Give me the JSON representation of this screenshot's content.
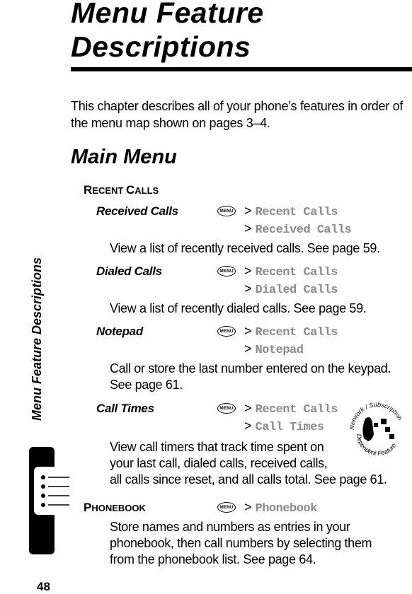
{
  "page": {
    "chapter_title_line1": "Menu Feature",
    "chapter_title_line2": "Descriptions",
    "intro": "This chapter describes all of your phone’s features in order of the menu map shown on pages 3–4.",
    "section_title": "Main Menu",
    "side_tab_title": "Menu Feature Descriptions",
    "page_number": "48",
    "menu_key_label": "MENU",
    "separator": ">",
    "badge": {
      "icon": "network-subscription-feature-icon",
      "top_text": "Network / Subscription",
      "bottom_text": "Dependent Feature"
    }
  },
  "recent_calls": {
    "heading_first": "R",
    "heading_rest1": "ECENT ",
    "heading_c": "C",
    "heading_rest2": "ALLS",
    "features": [
      {
        "name": "Received Calls",
        "path": [
          "Recent Calls",
          "Received Calls"
        ],
        "desc_lines": [
          "View a list of recently received calls. See page 59."
        ]
      },
      {
        "name": "Dialed Calls",
        "path": [
          "Recent Calls",
          "Dialed Calls"
        ],
        "desc_lines": [
          "View a list of recently dialed calls. See page 59."
        ]
      },
      {
        "name": "Notepad",
        "path": [
          "Recent Calls",
          "Notepad"
        ],
        "desc_lines": [
          "Call or store the last number entered on the keypad.",
          "See page 61."
        ]
      },
      {
        "name": "Call Times",
        "path": [
          "Recent Calls",
          "Call Times"
        ],
        "desc_lines": [
          "View call timers that track time spent on",
          "your last call, dialed calls, received calls,",
          "all calls since reset, and all calls total. See page 61."
        ]
      }
    ]
  },
  "phonebook": {
    "heading_first": "P",
    "heading_rest": "HONEBOOK",
    "path": [
      "Phonebook"
    ],
    "desc_lines": [
      "Store names and numbers as entries in your",
      "phonebook, then call numbers by selecting them",
      "from the phonebook list. See page 64."
    ]
  }
}
